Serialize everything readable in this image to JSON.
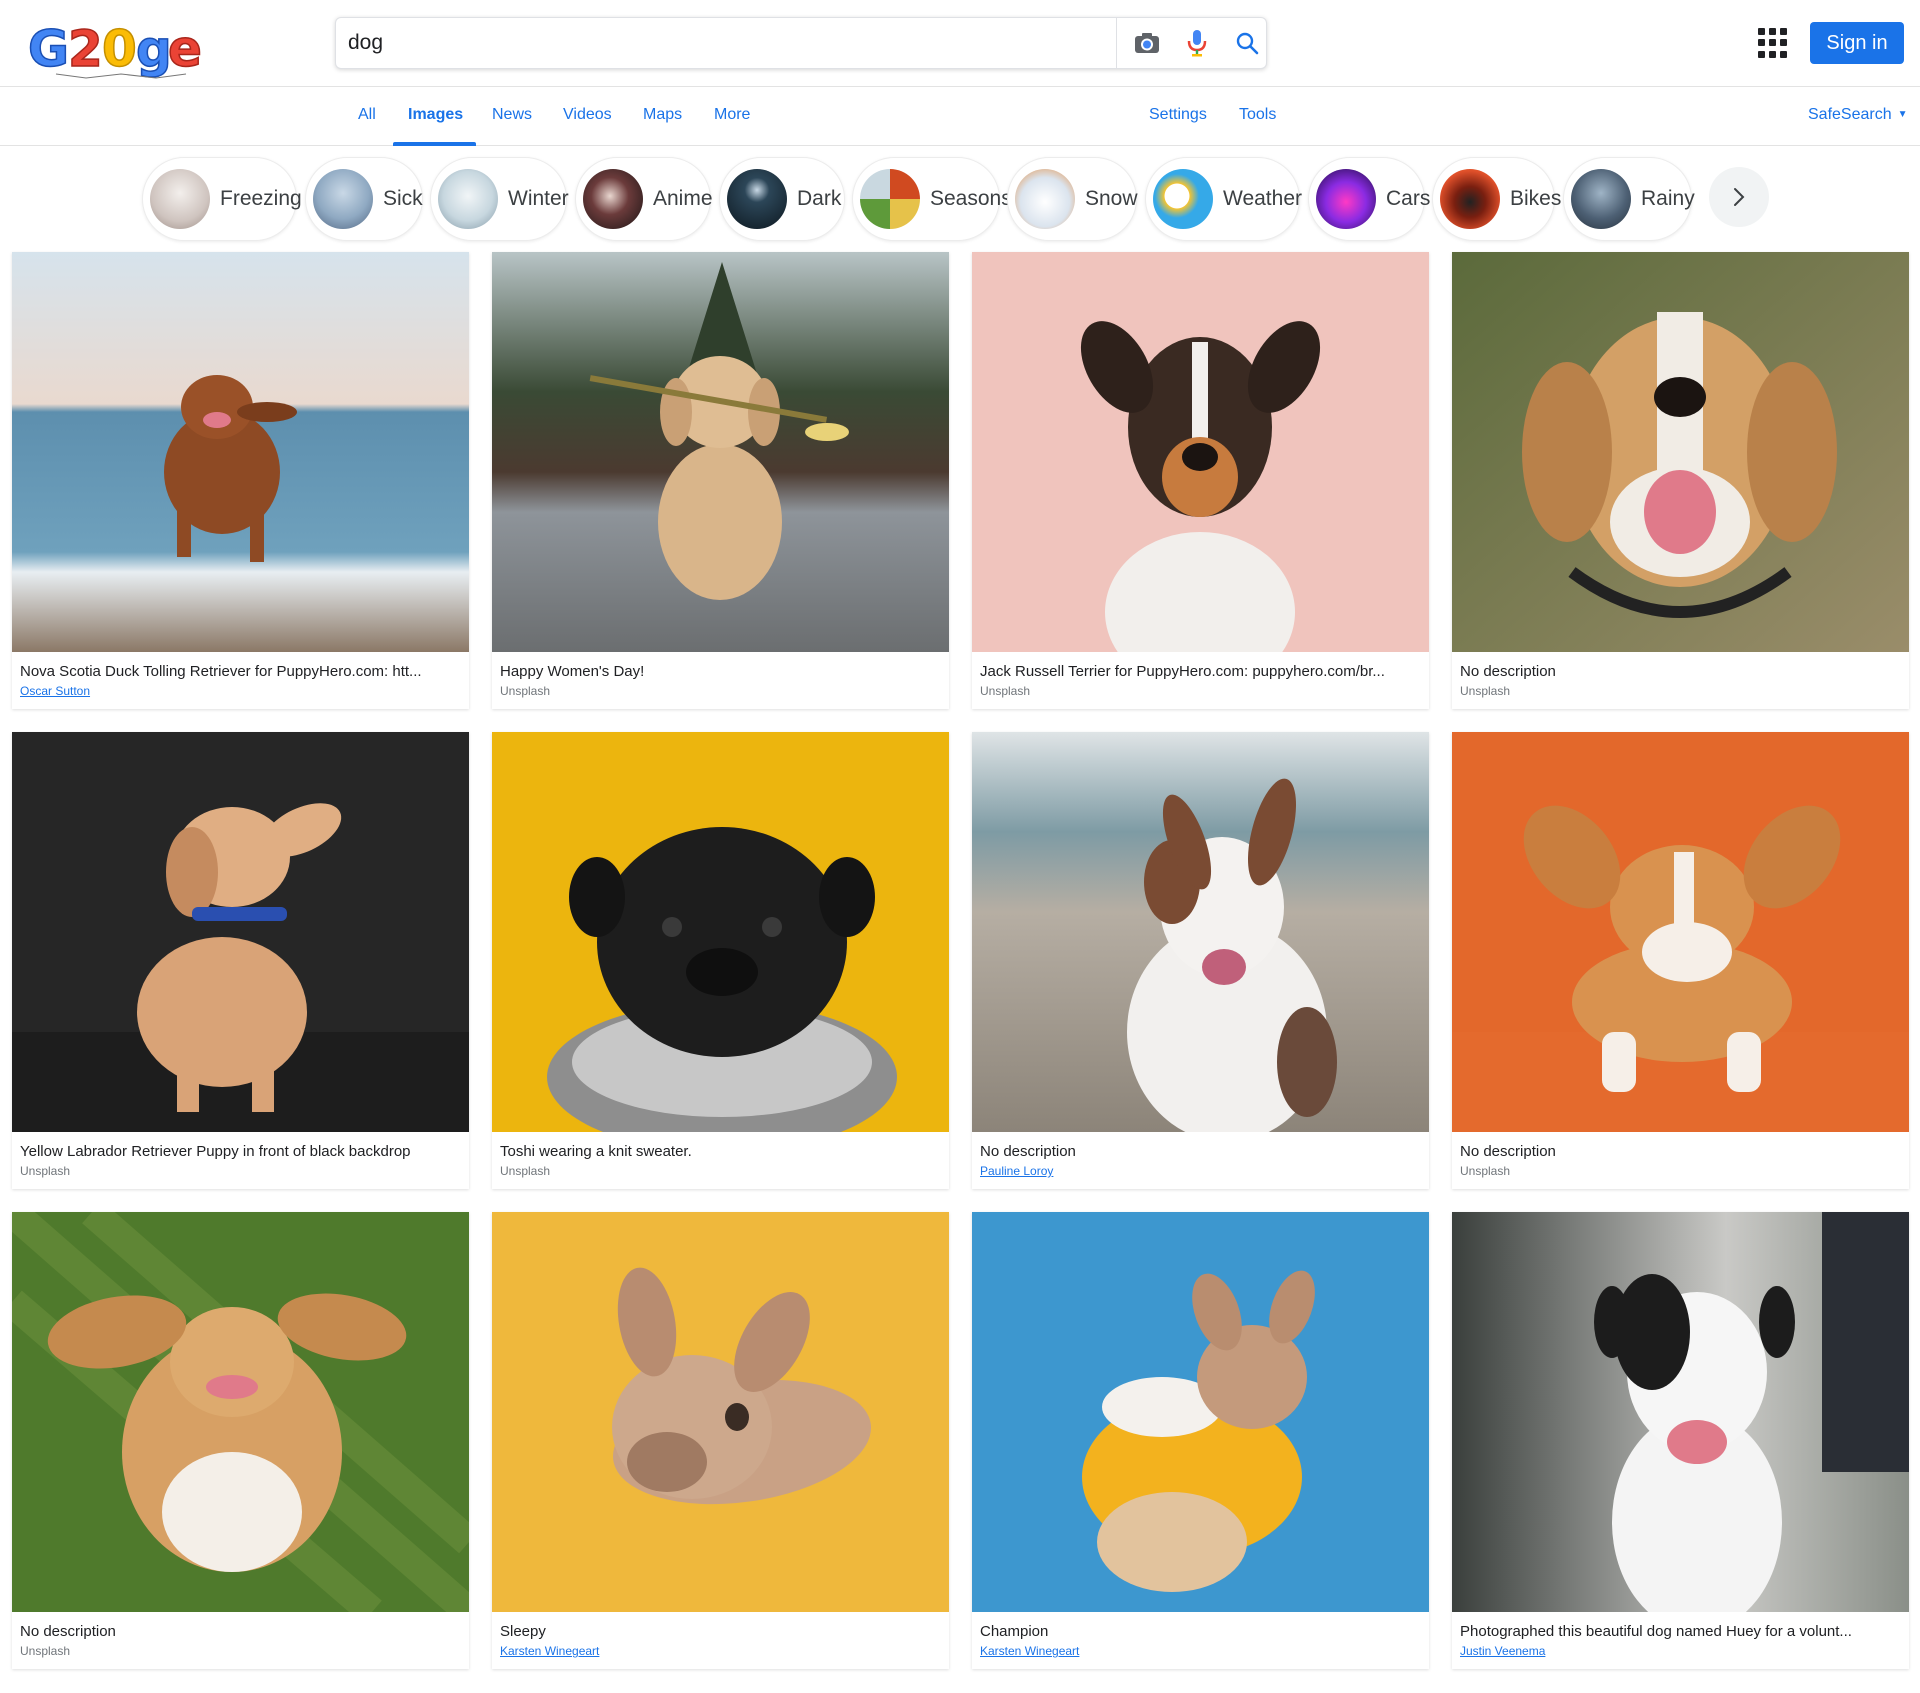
{
  "search": {
    "query": "dog",
    "placeholder": ""
  },
  "header": {
    "signin_label": "Sign in"
  },
  "nav": {
    "tabs": [
      {
        "label": "All"
      },
      {
        "label": "Images"
      },
      {
        "label": "News"
      },
      {
        "label": "Videos"
      },
      {
        "label": "Maps"
      },
      {
        "label": "More"
      },
      {
        "label": "Settings"
      },
      {
        "label": "Tools"
      }
    ],
    "active_tab": "Images",
    "safesearch_label": "SafeSearch"
  },
  "chips": [
    {
      "label": "Freezing",
      "color": "#d9d2cf"
    },
    {
      "label": "Sick",
      "color": "#8fa9c2"
    },
    {
      "label": "Winter",
      "color": "#c7d7df"
    },
    {
      "label": "Anime",
      "color": "#2b2222"
    },
    {
      "label": "Dark",
      "color": "#17252f"
    },
    {
      "label": "Seasons",
      "color": "#9b7b3a"
    },
    {
      "label": "Snow",
      "color": "#dbe4ee"
    },
    {
      "label": "Weather",
      "color": "#35a9e8"
    },
    {
      "label": "Cars",
      "color": "#5a1c9c"
    },
    {
      "label": "Bikes",
      "color": "#e0502a"
    },
    {
      "label": "Rainy",
      "color": "#4d6074"
    }
  ],
  "results": [
    {
      "title": "Nova Scotia Duck Tolling Retriever for PuppyHero.com: htt...",
      "source": "Oscar Sutton",
      "source_is_link": true,
      "bg": "#6fa1bd",
      "bg2": "#e9d9cf",
      "dog": "#8e4a24"
    },
    {
      "title": "Happy Women's Day!",
      "source": "Unsplash",
      "source_is_link": false,
      "bg": "#5a5d5b",
      "bg2": "#8e949a",
      "dog": "#d9b58a"
    },
    {
      "title": "Jack Russell Terrier for PuppyHero.com: puppyhero.com/br...",
      "source": "Unsplash",
      "source_is_link": false,
      "bg": "#f0c4bd",
      "bg2": "#f3ccc6",
      "dog": "#3a2a22"
    },
    {
      "title": "No description",
      "source": "Unsplash",
      "source_is_link": false,
      "bg": "#6d7350",
      "bg2": "#9a8d6a",
      "dog": "#d3a066"
    },
    {
      "title": "Yellow Labrador Retriever Puppy in front of black backdrop",
      "source": "Unsplash",
      "source_is_link": false,
      "bg": "#262626",
      "bg2": "#3b3b3b",
      "dog": "#d9a377"
    },
    {
      "title": "Toshi wearing a knit sweater.",
      "source": "Unsplash",
      "source_is_link": false,
      "bg": "#ecb50e",
      "bg2": "#ecb50e",
      "dog": "#1d1d1d"
    },
    {
      "title": "No description",
      "source": "Pauline Loroy",
      "source_is_link": true,
      "bg": "#a7a29a",
      "bg2": "#cfd7dc",
      "dog": "#f2f0ee"
    },
    {
      "title": "No description",
      "source": "Unsplash",
      "source_is_link": false,
      "bg": "#e3682b",
      "bg2": "#e8712f",
      "dog": "#d9924f"
    },
    {
      "title": "No description",
      "source": "Unsplash",
      "source_is_link": false,
      "bg": "#4f7a2c",
      "bg2": "#6b8f3b",
      "dog": "#d7a064"
    },
    {
      "title": "Sleepy",
      "source": "Karsten Winegeart",
      "source_is_link": true,
      "bg": "#efb83c",
      "bg2": "#f0be4a",
      "dog": "#c9a185"
    },
    {
      "title": "Champion",
      "source": "Karsten Winegeart",
      "source_is_link": true,
      "bg": "#3d97cf",
      "bg2": "#2f86be",
      "dog": "#f3b21e"
    },
    {
      "title": "Photographed this beautiful dog named Huey for a volunt...",
      "source": "Justin Veenema",
      "source_is_link": true,
      "bg": "#56605a",
      "bg2": "#c9c9c6",
      "dog": "#f4f4f4"
    }
  ]
}
